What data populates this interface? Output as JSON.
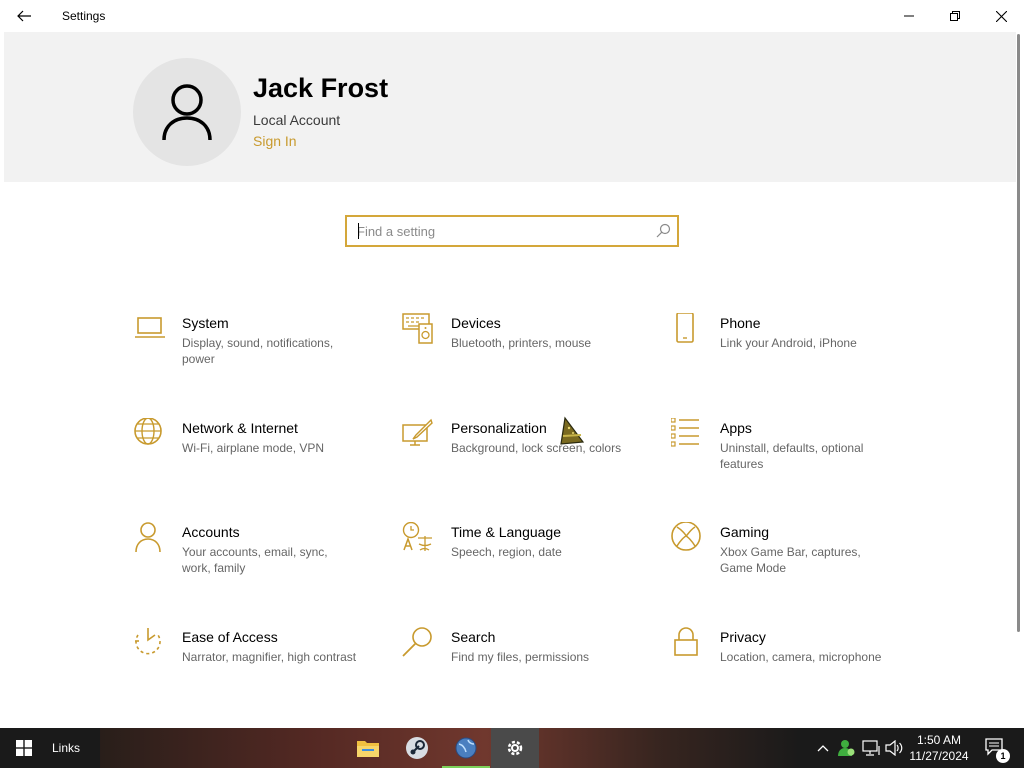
{
  "window": {
    "title": "Settings"
  },
  "user": {
    "name": "Jack Frost",
    "account_type": "Local Account",
    "sign_in": "Sign In"
  },
  "search": {
    "placeholder": "Find a setting"
  },
  "categories": [
    {
      "name": "System",
      "desc": "Display, sound, notifications, power"
    },
    {
      "name": "Devices",
      "desc": "Bluetooth, printers, mouse"
    },
    {
      "name": "Phone",
      "desc": "Link your Android, iPhone"
    },
    {
      "name": "Network & Internet",
      "desc": "Wi-Fi, airplane mode, VPN"
    },
    {
      "name": "Personalization",
      "desc": "Background, lock screen, colors"
    },
    {
      "name": "Apps",
      "desc": "Uninstall, defaults, optional features"
    },
    {
      "name": "Accounts",
      "desc": "Your accounts, email, sync, work, family"
    },
    {
      "name": "Time & Language",
      "desc": "Speech, region, date"
    },
    {
      "name": "Gaming",
      "desc": "Xbox Game Bar, captures, Game Mode"
    },
    {
      "name": "Ease of Access",
      "desc": "Narrator, magnifier, high contrast"
    },
    {
      "name": "Search",
      "desc": "Find my files, permissions"
    },
    {
      "name": "Privacy",
      "desc": "Location, camera, microphone"
    }
  ],
  "taskbar": {
    "toolbar_label": "Links",
    "time": "1:50 AM",
    "date": "11/27/2024",
    "notification_count": "1"
  },
  "colors": {
    "accent": "#c89a2e",
    "header_bg": "#f2f2f2",
    "taskbar_bg": "#1a1a1a"
  }
}
